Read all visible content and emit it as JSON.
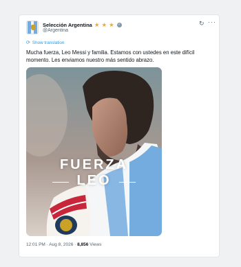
{
  "account": {
    "name": "Selección Argentina",
    "handle": "@Argentina",
    "stars": [
      "★",
      "★",
      "★"
    ],
    "verified_glyph": "✓"
  },
  "translate_label": "Show translation",
  "tweet_text": "Mucha fuerza, Leo Messi y familia. Estamos con ustedes en este difícil momento. Les enviamos nuestro más sentido abrazo.",
  "image_text": {
    "line1": "FUERZA",
    "line2": "LEO"
  },
  "meta": {
    "time": "12:01 PM",
    "date": "Aug 8, 2026",
    "views_count": "8,856",
    "views_label": "Views"
  },
  "colors": {
    "accent": "#1d9bf0",
    "star": "#f2a922",
    "argentina_blue": "#74acdf"
  }
}
